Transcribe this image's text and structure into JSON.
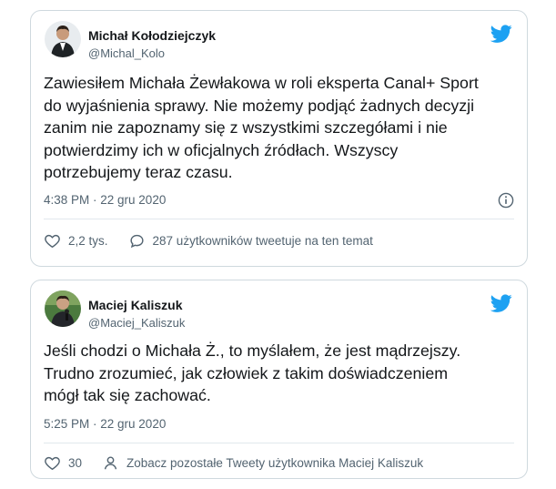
{
  "tweets": [
    {
      "author_name": "Michał Kołodziejczyk",
      "author_handle": "@Michal_Kolo",
      "text_lines": [
        "Zawiesiłem Michała Żewłakowa w roli eksperta Canal+ Sport",
        "do wyjaśnienia sprawy. Nie możemy podjąć żadnych decyzji",
        "zanim nie zapoznamy się z wszystkimi szczegółami i nie",
        "potwierdzimy ich w oficjalnych źródłach. Wszyscy",
        "potrzebujemy teraz czasu."
      ],
      "timestamp": "4:38 PM · 22 gru 2020",
      "likes": "2,2 tys.",
      "replies_label": "287 użytkowników tweetuje na ten temat"
    },
    {
      "author_name": "Maciej Kaliszuk",
      "author_handle": "@Maciej_Kaliszuk",
      "text_lines": [
        "Jeśli chodzi o Michała Ż., to myślałem, że jest mądrzejszy.",
        "Trudno zrozumieć, jak człowiek z takim doświadczeniem",
        "mógł tak się zachować."
      ],
      "timestamp": "5:25 PM · 22 gru 2020",
      "likes": "30",
      "more_label": "Zobacz pozostałe Tweety użytkownika Maciej Kaliszuk"
    }
  ],
  "icons": {
    "brand": "twitter-bird-icon",
    "info": "info-icon",
    "like": "heart-icon",
    "reply": "speech-bubble-icon",
    "profile": "person-icon"
  },
  "colors": {
    "twitter_blue": "#1da1f2",
    "secondary_text": "#536471",
    "border": "#cfd9de"
  }
}
